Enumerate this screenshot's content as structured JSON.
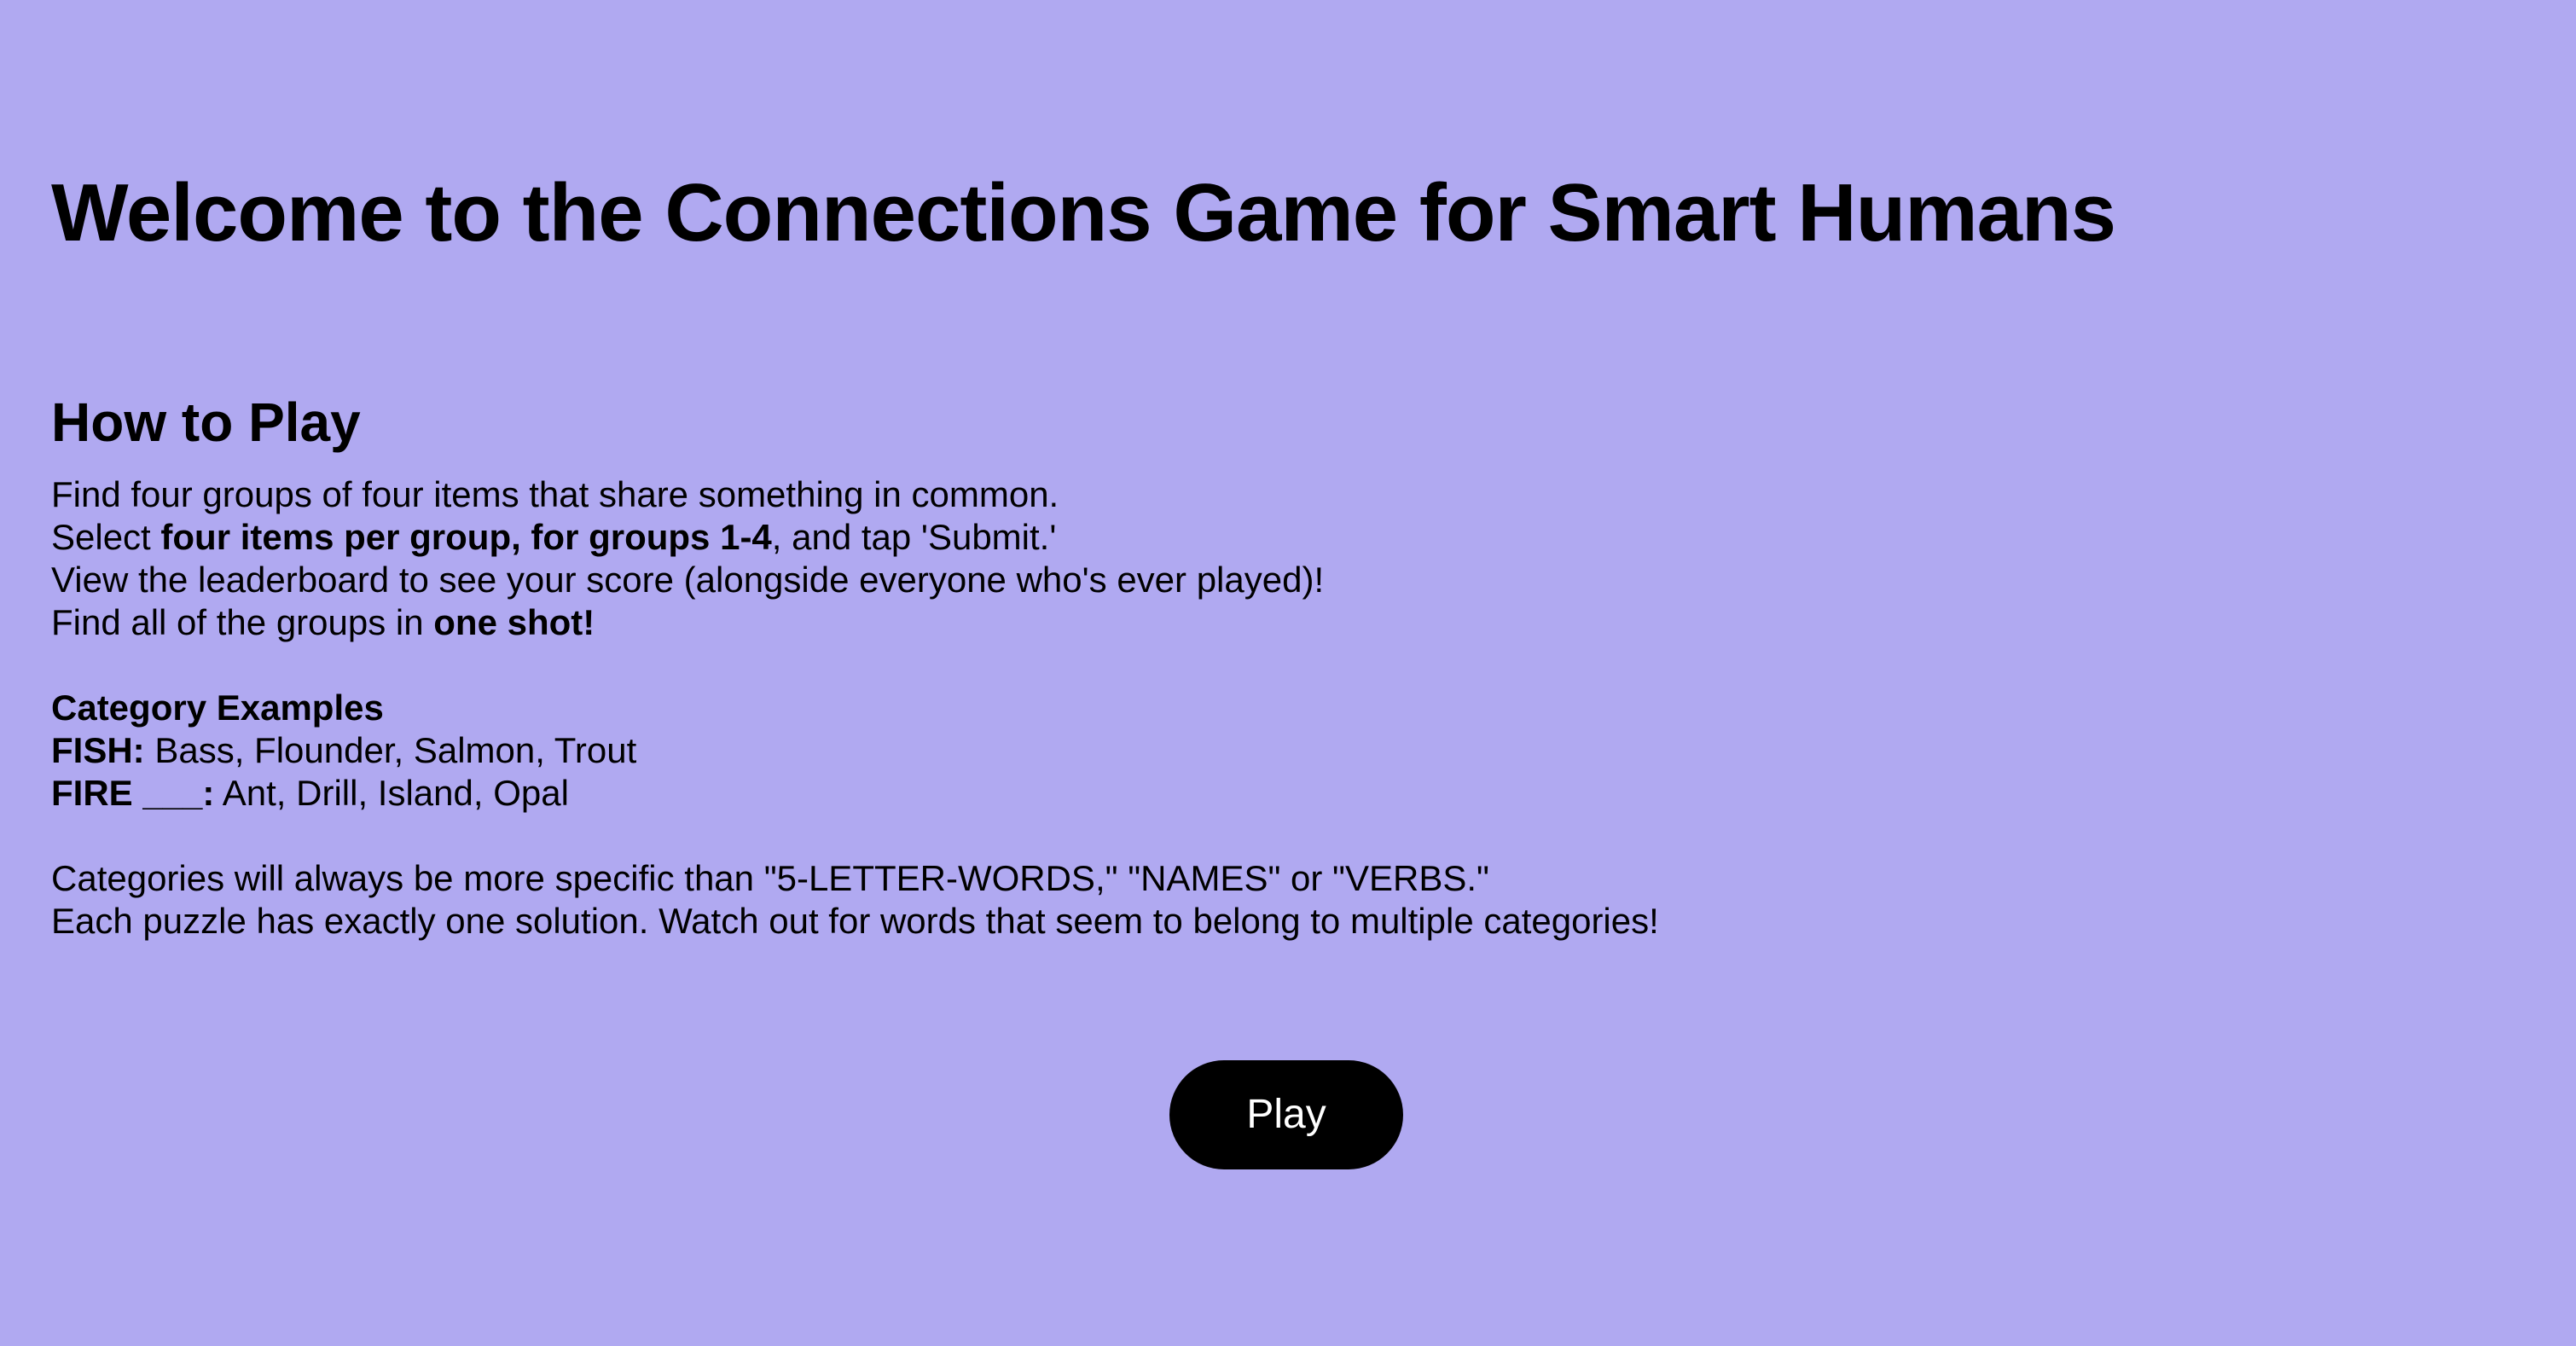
{
  "colors": {
    "background": "#b0a9f1",
    "text": "#000000",
    "button_bg": "#000000",
    "button_text": "#ffffff"
  },
  "title": "Welcome to the Connections Game for Smart Humans",
  "how_to_play": {
    "heading": "How to Play",
    "line1": "Find four groups of four items that share something in common.",
    "line2_pre": "Select ",
    "line2_bold": "four items per group, for groups 1-4",
    "line2_post": ", and tap 'Submit.'",
    "line3": "View the leaderboard to see your score (alongside everyone who's ever played)!",
    "line4_pre": "Find all of the groups in ",
    "line4_bold": "one shot!"
  },
  "examples": {
    "heading": "Category Examples",
    "items": [
      {
        "label": "FISH:",
        "words": " Bass, Flounder, Salmon, Trout"
      },
      {
        "label": "FIRE ___:",
        "words": " Ant, Drill, Island, Opal"
      }
    ]
  },
  "notes": {
    "line1": "Categories will always be more specific than \"5-LETTER-WORDS,\" \"NAMES\" or \"VERBS.\"",
    "line2": "Each puzzle has exactly one solution. Watch out for words that seem to belong to multiple categories!"
  },
  "play_button": {
    "label": "Play"
  }
}
